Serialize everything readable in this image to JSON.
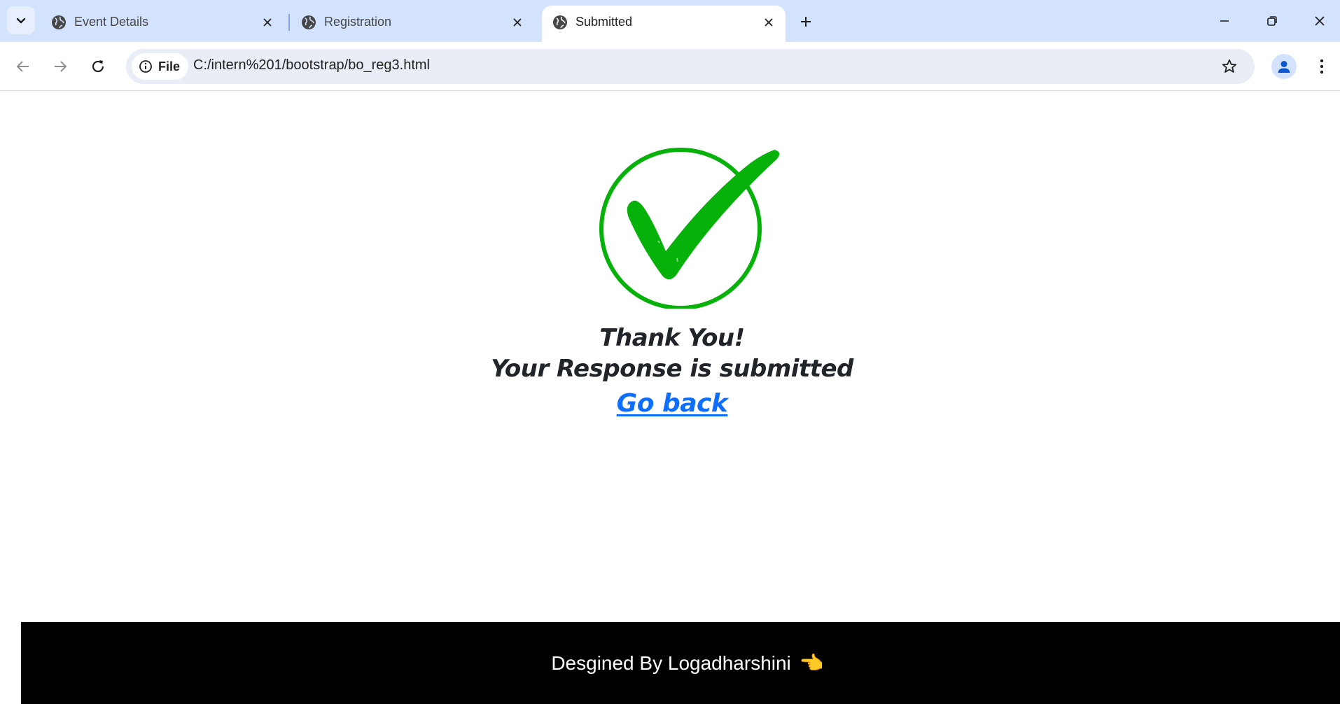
{
  "browser": {
    "tabs": [
      {
        "title": "Event Details",
        "active": false
      },
      {
        "title": "Registration",
        "active": false
      },
      {
        "title": "Submitted",
        "active": true
      }
    ],
    "address": {
      "chip_label": "File",
      "url": "C:/intern%201/bootstrap/bo_reg3.html"
    }
  },
  "page": {
    "heading_line1": "Thank You!",
    "heading_line2": "Your Response is submitted",
    "link_label": "Go back",
    "footer_text": "Desgined By Logadharshini",
    "footer_emoji": "👈"
  },
  "colors": {
    "tabstrip": "#d3e3fd",
    "check_green": "#06b10a",
    "link_blue": "#0d6efd",
    "footer_bg": "#000000"
  }
}
